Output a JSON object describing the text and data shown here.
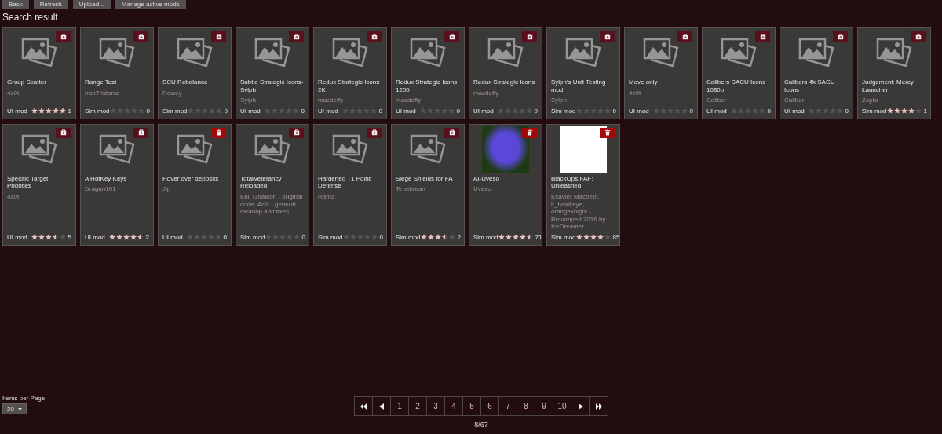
{
  "toolbar": [
    "Back",
    "Refresh",
    "Upload...",
    "Manage active mods"
  ],
  "heading": "Search result",
  "mods": [
    {
      "title": "Group Scatter",
      "author": "4z0t",
      "type": "UI mod",
      "stars": 5,
      "count": "1",
      "thumbnail": {
        "kind": "placeholder"
      },
      "action": {
        "kind": "install"
      }
    },
    {
      "title": "Range Test",
      "author": "IronTristonia",
      "type": "Sim mod",
      "stars": 0,
      "count": "0",
      "thumbnail": {
        "kind": "placeholder"
      },
      "action": {
        "kind": "install"
      }
    },
    {
      "title": "SCU Rebalance",
      "author": "Rowey",
      "type": "Sim mod",
      "stars": 0,
      "count": "0",
      "thumbnail": {
        "kind": "placeholder"
      },
      "action": {
        "kind": "install"
      }
    },
    {
      "title": "Subtle Strategic Icons-Sylph",
      "author": "Sylph",
      "type": "UI mod",
      "stars": 0,
      "count": "0",
      "thumbnail": {
        "kind": "placeholder"
      },
      "action": {
        "kind": "install"
      }
    },
    {
      "title": "Redux Strategic Icons 2K",
      "author": "macdeffy",
      "type": "UI mod",
      "stars": 0,
      "count": "0",
      "thumbnail": {
        "kind": "placeholder"
      },
      "action": {
        "kind": "install"
      }
    },
    {
      "title": "Redux Strategic Icons 1200",
      "author": "macdeffy",
      "type": "UI mod",
      "stars": 0,
      "count": "0",
      "thumbnail": {
        "kind": "placeholder"
      },
      "action": {
        "kind": "install"
      }
    },
    {
      "title": "Redux Strategic Icons",
      "author": "macdeffy",
      "type": "UI mod",
      "stars": 0,
      "count": "0",
      "thumbnail": {
        "kind": "placeholder"
      },
      "action": {
        "kind": "install"
      }
    },
    {
      "title": "Sylph's Unit Testing mod",
      "author": "Sylph",
      "type": "Sim mod",
      "stars": 0,
      "count": "0",
      "thumbnail": {
        "kind": "placeholder"
      },
      "action": {
        "kind": "install"
      }
    },
    {
      "title": "Move only",
      "author": "4z0t",
      "type": "UI mod",
      "stars": 0,
      "count": "0",
      "thumbnail": {
        "kind": "placeholder"
      },
      "action": {
        "kind": "install"
      }
    },
    {
      "title": "Calibers SACU Icons 1080p",
      "author": "Caliber",
      "type": "UI mod",
      "stars": 0,
      "count": "0",
      "thumbnail": {
        "kind": "placeholder"
      },
      "action": {
        "kind": "install"
      }
    },
    {
      "title": "Calibers 4k SACU Icons",
      "author": "Caliber",
      "type": "UI mod",
      "stars": 0,
      "count": "0",
      "thumbnail": {
        "kind": "placeholder"
      },
      "action": {
        "kind": "install"
      }
    },
    {
      "title": "Judgement: Mercy Launcher",
      "author": "Zopto",
      "type": "Sim mod",
      "stars": 4,
      "count": "1",
      "thumbnail": {
        "kind": "placeholder"
      },
      "action": {
        "kind": "install"
      }
    },
    {
      "title": "Specific Target Priorities",
      "author": "4z0t",
      "type": "UI mod",
      "stars": 3.5,
      "count": "5",
      "thumbnail": {
        "kind": "placeholder"
      },
      "action": {
        "kind": "install"
      }
    },
    {
      "title": "A HotKey Keys",
      "author": "Dragun101",
      "type": "UI mod",
      "stars": 4.5,
      "count": "2",
      "thumbnail": {
        "kind": "placeholder"
      },
      "action": {
        "kind": "install"
      }
    },
    {
      "title": "Hover over deposits",
      "author": "Jip",
      "type": "UI mod",
      "stars": 0,
      "count": "0",
      "thumbnail": {
        "kind": "placeholder"
      },
      "action": {
        "kind": "remove"
      }
    },
    {
      "title": "TotalVeterancy Reloaded",
      "author": "Eni, Ghaleon - original code, 4z0t - general cleanup and fixes",
      "type": "Sim mod",
      "stars": 0,
      "count": "0",
      "thumbnail": {
        "kind": "placeholder"
      },
      "action": {
        "kind": "install"
      }
    },
    {
      "title": "Hardened T1 Point Defense",
      "author": "Rama",
      "type": "Sim mod",
      "stars": 0,
      "count": "0",
      "thumbnail": {
        "kind": "placeholder"
      },
      "action": {
        "kind": "install"
      }
    },
    {
      "title": "Siege Shields for FA",
      "author": "Tenebrean",
      "type": "Sim mod",
      "stars": 3.5,
      "count": "2",
      "thumbnail": {
        "kind": "placeholder"
      },
      "action": {
        "kind": "install"
      }
    },
    {
      "title": "AI-Uveso",
      "author": "Uveso",
      "type": "Sim mod",
      "stars": 4.5,
      "count": "71",
      "thumbnail": {
        "kind": "photo"
      },
      "action": {
        "kind": "remove"
      }
    },
    {
      "title": "BlackOps FAF: Unleashed",
      "author": "Exavier Macbeth, lt_hawkeye, orangeknight - Revamped 2016 by IceDreamer",
      "type": "Sim mod",
      "stars": 4,
      "count": "85",
      "thumbnail": {
        "kind": "photo"
      },
      "action": {
        "kind": "remove"
      }
    }
  ],
  "items_per_page": {
    "label": "Items per Page",
    "value": "20"
  },
  "pagination": {
    "pages": [
      "1",
      "2",
      "3",
      "4",
      "5",
      "6",
      "7",
      "8",
      "9",
      "10"
    ],
    "status": "8/67"
  }
}
